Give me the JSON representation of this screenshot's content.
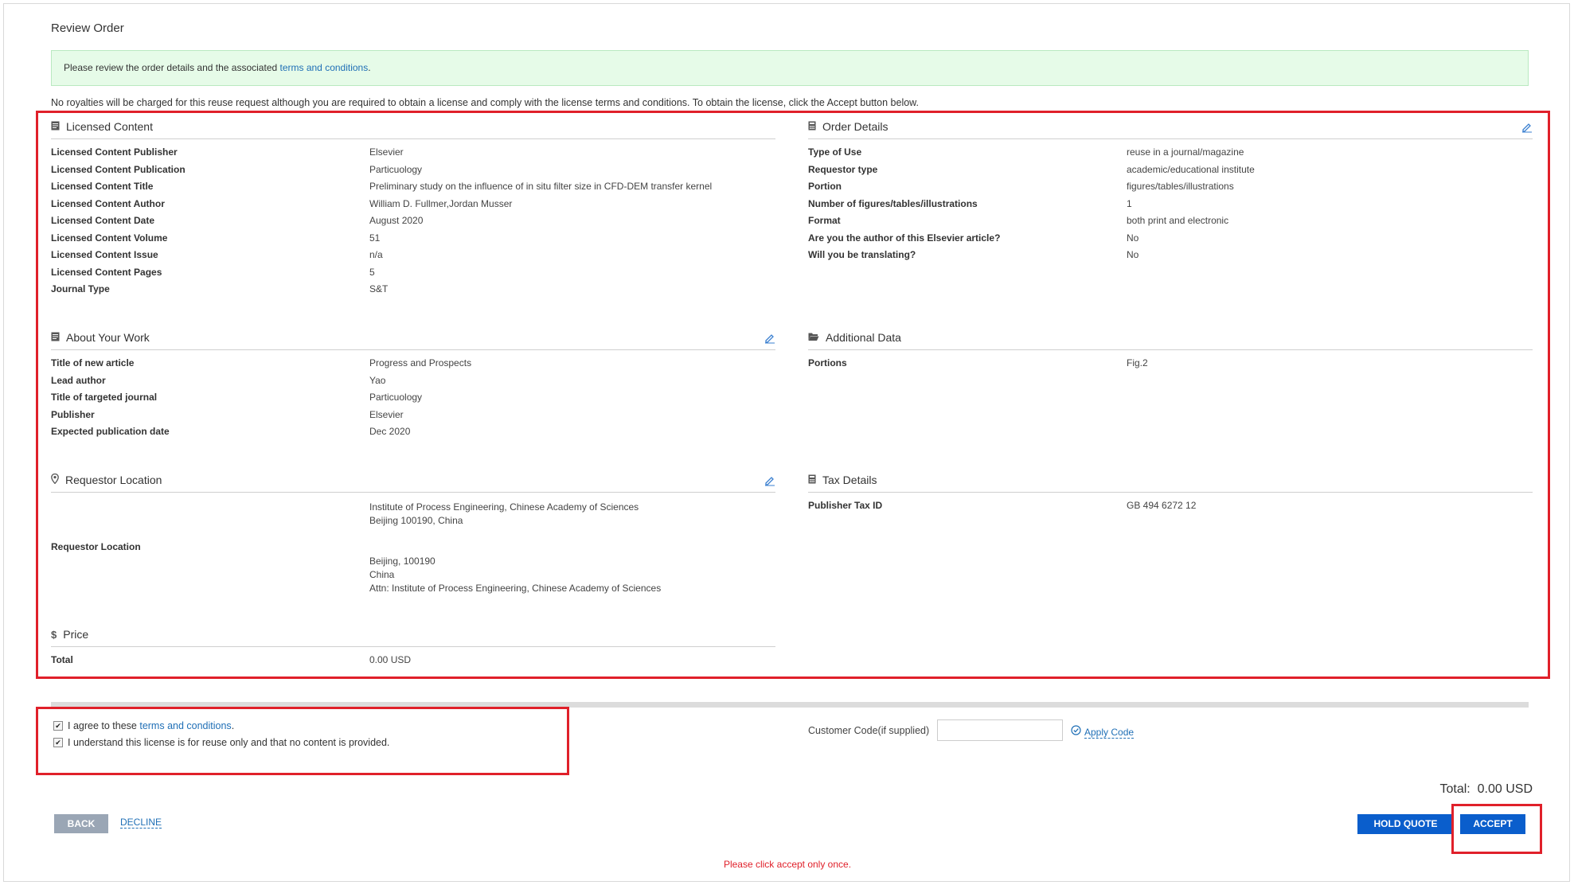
{
  "page_title": "Review Order",
  "notice": {
    "text": "Please review the order details and the associated ",
    "link": "terms and conditions",
    "suffix": "."
  },
  "royalty_text": "No royalties will be charged for this reuse request although you are required to obtain a license and comply with the license terms and conditions. To obtain the license, click the Accept button below.",
  "licensed_content": {
    "title": "Licensed Content",
    "rows": [
      {
        "label": "Licensed Content Publisher",
        "value": "Elsevier"
      },
      {
        "label": "Licensed Content Publication",
        "value": "Particuology"
      },
      {
        "label": "Licensed Content Title",
        "value": "Preliminary study on the influence of in situ filter size in CFD-DEM transfer kernel"
      },
      {
        "label": "Licensed Content Author",
        "value": "William D. Fullmer,Jordan Musser"
      },
      {
        "label": "Licensed Content Date",
        "value": "August 2020"
      },
      {
        "label": "Licensed Content Volume",
        "value": "51"
      },
      {
        "label": "Licensed Content Issue",
        "value": "n/a"
      },
      {
        "label": "Licensed Content Pages",
        "value": "5"
      },
      {
        "label": "Journal Type",
        "value": "S&T"
      }
    ]
  },
  "order_details": {
    "title": "Order Details",
    "rows": [
      {
        "label": "Type of Use",
        "value": "reuse in a journal/magazine"
      },
      {
        "label": "Requestor type",
        "value": "academic/educational institute"
      },
      {
        "label": "Portion",
        "value": "figures/tables/illustrations"
      },
      {
        "label": "Number of figures/tables/illustrations",
        "value": "1"
      },
      {
        "label": "Format",
        "value": "both print and electronic"
      },
      {
        "label": "Are you the author of this Elsevier article?",
        "value": "No"
      },
      {
        "label": "Will you be translating?",
        "value": "No"
      }
    ]
  },
  "about_work": {
    "title": "About Your Work",
    "rows": [
      {
        "label": "Title of new article",
        "value": "Progress and Prospects"
      },
      {
        "label": "Lead author",
        "value": "Yao"
      },
      {
        "label": "Title of targeted journal",
        "value": "Particuology"
      },
      {
        "label": "Publisher",
        "value": "Elsevier"
      },
      {
        "label": "Expected publication date",
        "value": "Dec 2020"
      }
    ]
  },
  "additional_data": {
    "title": "Additional Data",
    "rows": [
      {
        "label": "Portions",
        "value": "Fig.2"
      }
    ]
  },
  "requestor_location": {
    "title": "Requestor Location",
    "label": "Requestor Location",
    "lines": [
      "Institute of Process Engineering, Chinese Academy of Sciences",
      "Beijing 100190, China",
      "Beijing, 100190",
      "China",
      "Attn: Institute of Process Engineering, Chinese Academy of Sciences"
    ]
  },
  "tax_details": {
    "title": "Tax Details",
    "rows": [
      {
        "label": "Publisher Tax ID",
        "value": "GB 494 6272 12"
      }
    ]
  },
  "price": {
    "title": "Price",
    "rows": [
      {
        "label": "Total",
        "value": "0.00 USD"
      }
    ]
  },
  "agreements": {
    "agree_prefix": "I agree to these ",
    "agree_link": "terms and conditions",
    "agree_suffix": ".",
    "understand": "I understand this license is for reuse only and that no content is provided."
  },
  "customer_code": {
    "label": "Customer Code(if supplied)",
    "value": "",
    "apply": "Apply Code"
  },
  "total_display": "Total:  0.00 USD",
  "buttons": {
    "back": "BACK",
    "decline": "DECLINE",
    "hold_quote": "HOLD QUOTE",
    "accept": "ACCEPT"
  },
  "warning": "Please click accept only once.",
  "colors": {
    "accent": "#0a5ecc",
    "link": "#1f6fb6",
    "highlight_box": "#e0202a",
    "warning": "#e0202a",
    "notice_bg": "#e6fbe8"
  }
}
